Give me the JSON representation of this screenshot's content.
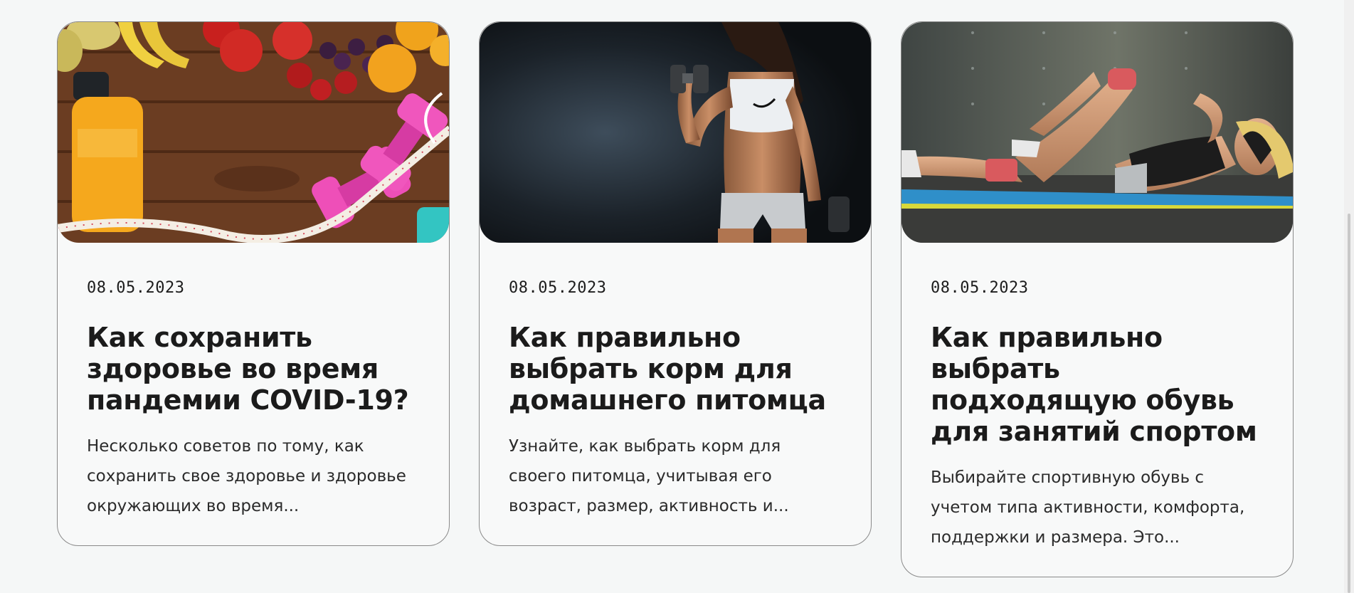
{
  "articles": [
    {
      "image": "fitness-flatlay-fruits-dumbbells",
      "date": "08.05.2023",
      "title": "Как сохранить здоровье во время пандемии COVID-19?",
      "excerpt": "Несколько советов по тому, как сохранить свое здоровье и здоровье окружающих во время..."
    },
    {
      "image": "woman-with-dumbbell-dark-background",
      "date": "08.05.2023",
      "title": "Как правильно выбрать корм для домашнего питомца",
      "excerpt": "Узнайте, как выбрать корм для своего питомца, учитывая его возраст, размер, активность и..."
    },
    {
      "image": "woman-doing-crunches-on-mat",
      "date": "08.05.2023",
      "title": "Как правильно выбрать подходящую обувь для занятий спортом",
      "excerpt": "Выбирайте спортивную обувь с учетом типа активности, комфорта, поддержки и размера. Это..."
    }
  ],
  "colors": {
    "background": "#f5f7f7",
    "card_border": "#8a8a8a",
    "text": "#1b1b1b"
  }
}
